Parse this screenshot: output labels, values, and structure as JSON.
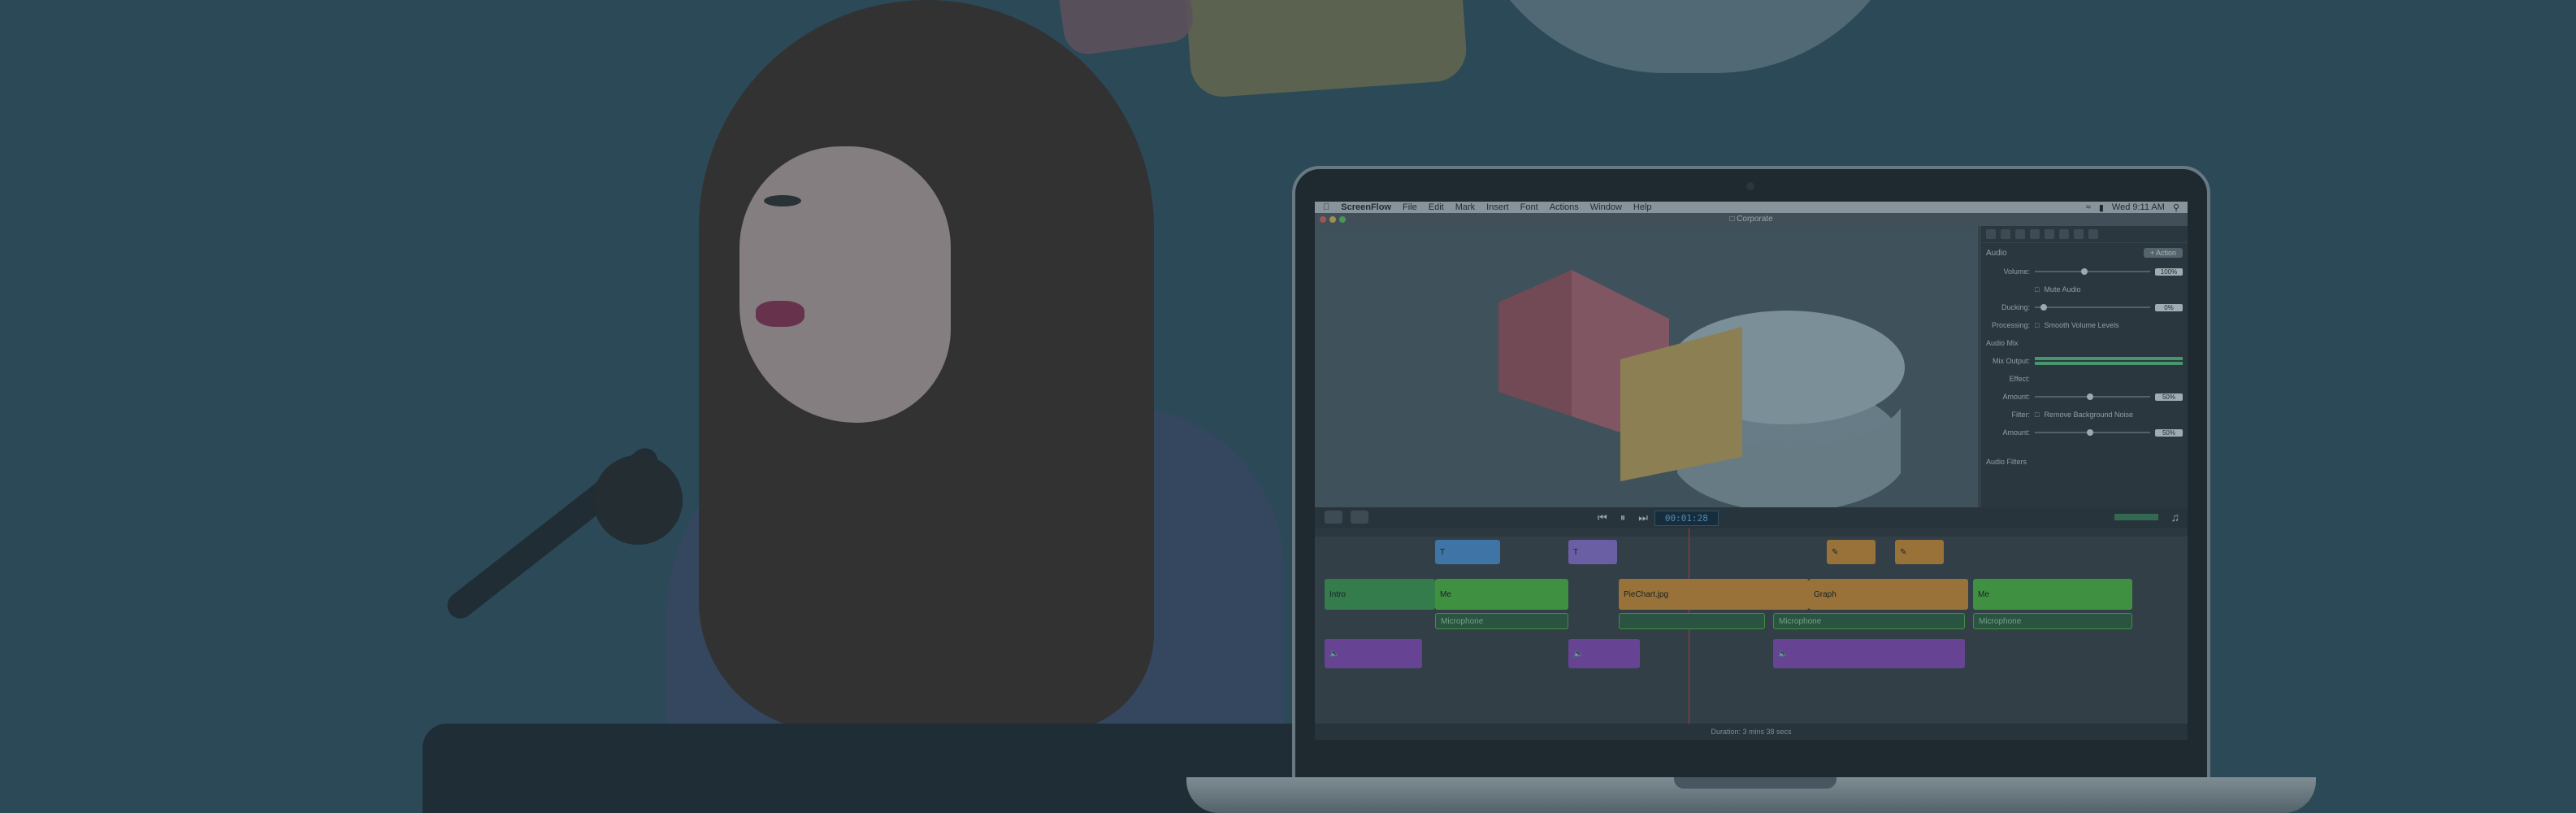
{
  "menubar": {
    "app": "ScreenFlow",
    "items": [
      "File",
      "Edit",
      "Mark",
      "Insert",
      "Font",
      "Actions",
      "Window",
      "Help"
    ],
    "clock": "Wed 9:11 AM"
  },
  "window": {
    "title": "Corporate"
  },
  "inspector": {
    "section": "Audio",
    "action_label": "+ Action",
    "volume_label": "Volume:",
    "volume_value": "100%",
    "mute_label": "Mute Audio",
    "ducking_label": "Ducking:",
    "ducking_value": "0%",
    "processing_label": "Processing:",
    "smooth_label": "Smooth Volume Levels",
    "audio_mix_label": "Audio Mix",
    "mix_output_label": "Mix Output:",
    "effect_label": "Effect:",
    "amount_label": "Amount:",
    "amount_value": "50%",
    "filter_label": "Filter:",
    "remove_bg_label": "Remove Background Noise",
    "amount2_label": "Amount:",
    "amount2_value": "50%",
    "audio_filters_label": "Audio Filters"
  },
  "transport": {
    "timecode": "00:01:28"
  },
  "timeline": {
    "clips": {
      "intro": "Intro",
      "me1": "Me",
      "piechart": "PieChart.jpg",
      "graph": "Graph",
      "me2": "Me",
      "mic1": "Microphone",
      "mic2": "Microphone",
      "mic3": "Microphone"
    }
  },
  "status": {
    "duration": "Duration: 3 mins 38 secs"
  },
  "colors": {
    "background": "#2f4d5b",
    "timecode_text": "#6fb0de",
    "playhead": "#e53a3a"
  }
}
